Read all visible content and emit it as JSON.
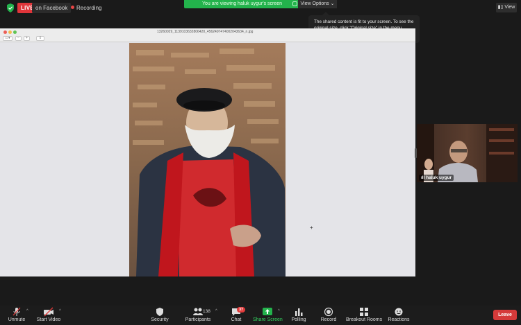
{
  "topbar": {
    "live_label": "LIVE",
    "platform_label": "on Facebook",
    "recording_label": "Recording",
    "viewing_banner": "You are viewing haluk uygur's screen",
    "view_options_label": "View Options",
    "view_button_label": "View"
  },
  "tooltip": {
    "text": "The shared content is fit to your screen. To see the original size, click \"Original size\" in the menu."
  },
  "shared_window": {
    "filename": "13260029_1139103632806420_4562497474002043634_n.jpg"
  },
  "participant": {
    "name": "haluk uygur"
  },
  "toolbar": {
    "unmute": "Unmute",
    "start_video": "Start Video",
    "security": "Security",
    "participants": "Participants",
    "participants_count": "138",
    "chat": "Chat",
    "chat_badge": "37",
    "share_screen": "Share Screen",
    "polling": "Polling",
    "record": "Record",
    "breakout_rooms": "Breakout Rooms",
    "reactions": "Reactions",
    "leave": "Leave"
  },
  "colors": {
    "live_red": "#e0353a",
    "share_green": "#23b34c",
    "leave_red": "#d53a3a",
    "background": "#1a1a1a"
  }
}
